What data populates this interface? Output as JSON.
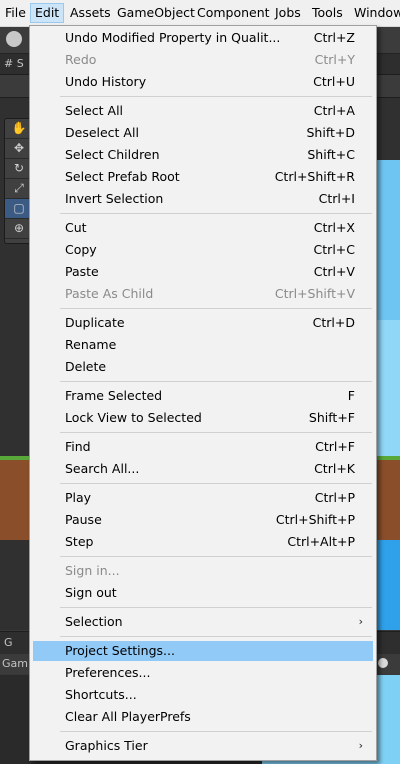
{
  "menubar": {
    "items": [
      "File",
      "Edit",
      "Assets",
      "GameObject",
      "Component",
      "Jobs",
      "Tools",
      "Window"
    ]
  },
  "background": {
    "scene_tab": "# S",
    "game_tab": "G",
    "game_label": "Gam",
    "tool_icons": [
      "hand-icon",
      "move-icon",
      "rotate-icon",
      "scale-icon",
      "rect-icon",
      "transform-icon"
    ],
    "colors": {
      "sky": "#6fc5f2",
      "grass": "#58a83a",
      "dirt": "#8a4f2a"
    }
  },
  "edit_menu": {
    "groups": [
      [
        {
          "label": "Undo Modified Property in Qualit...",
          "shortcut": "Ctrl+Z",
          "enabled": true
        },
        {
          "label": "Redo",
          "shortcut": "Ctrl+Y",
          "enabled": false
        },
        {
          "label": "Undo History",
          "shortcut": "Ctrl+U",
          "enabled": true
        }
      ],
      [
        {
          "label": "Select All",
          "shortcut": "Ctrl+A",
          "enabled": true
        },
        {
          "label": "Deselect All",
          "shortcut": "Shift+D",
          "enabled": true
        },
        {
          "label": "Select Children",
          "shortcut": "Shift+C",
          "enabled": true
        },
        {
          "label": "Select Prefab Root",
          "shortcut": "Ctrl+Shift+R",
          "enabled": true
        },
        {
          "label": "Invert Selection",
          "shortcut": "Ctrl+I",
          "enabled": true
        }
      ],
      [
        {
          "label": "Cut",
          "shortcut": "Ctrl+X",
          "enabled": true
        },
        {
          "label": "Copy",
          "shortcut": "Ctrl+C",
          "enabled": true
        },
        {
          "label": "Paste",
          "shortcut": "Ctrl+V",
          "enabled": true
        },
        {
          "label": "Paste As Child",
          "shortcut": "Ctrl+Shift+V",
          "enabled": false
        }
      ],
      [
        {
          "label": "Duplicate",
          "shortcut": "Ctrl+D",
          "enabled": true
        },
        {
          "label": "Rename",
          "shortcut": "",
          "enabled": true
        },
        {
          "label": "Delete",
          "shortcut": "",
          "enabled": true
        }
      ],
      [
        {
          "label": "Frame Selected",
          "shortcut": "F",
          "enabled": true
        },
        {
          "label": "Lock View to Selected",
          "shortcut": "Shift+F",
          "enabled": true
        }
      ],
      [
        {
          "label": "Find",
          "shortcut": "Ctrl+F",
          "enabled": true
        },
        {
          "label": "Search All...",
          "shortcut": "Ctrl+K",
          "enabled": true
        }
      ],
      [
        {
          "label": "Play",
          "shortcut": "Ctrl+P",
          "enabled": true
        },
        {
          "label": "Pause",
          "shortcut": "Ctrl+Shift+P",
          "enabled": true
        },
        {
          "label": "Step",
          "shortcut": "Ctrl+Alt+P",
          "enabled": true
        }
      ],
      [
        {
          "label": "Sign in...",
          "shortcut": "",
          "enabled": false
        },
        {
          "label": "Sign out",
          "shortcut": "",
          "enabled": true
        }
      ],
      [
        {
          "label": "Selection",
          "shortcut": "",
          "enabled": true,
          "submenu": true
        }
      ],
      [
        {
          "label": "Project Settings...",
          "shortcut": "",
          "enabled": true,
          "highlighted": true
        },
        {
          "label": "Preferences...",
          "shortcut": "",
          "enabled": true
        },
        {
          "label": "Shortcuts...",
          "shortcut": "",
          "enabled": true
        },
        {
          "label": "Clear All PlayerPrefs",
          "shortcut": "",
          "enabled": true
        }
      ],
      [
        {
          "label": "Graphics Tier",
          "shortcut": "",
          "enabled": true,
          "submenu": true
        }
      ]
    ],
    "submenu_arrow": "›",
    "colors": {
      "highlight": "#91c9f7",
      "disabled_text": "#8a8a8a",
      "active_menu_bg": "#cce4f7"
    }
  }
}
